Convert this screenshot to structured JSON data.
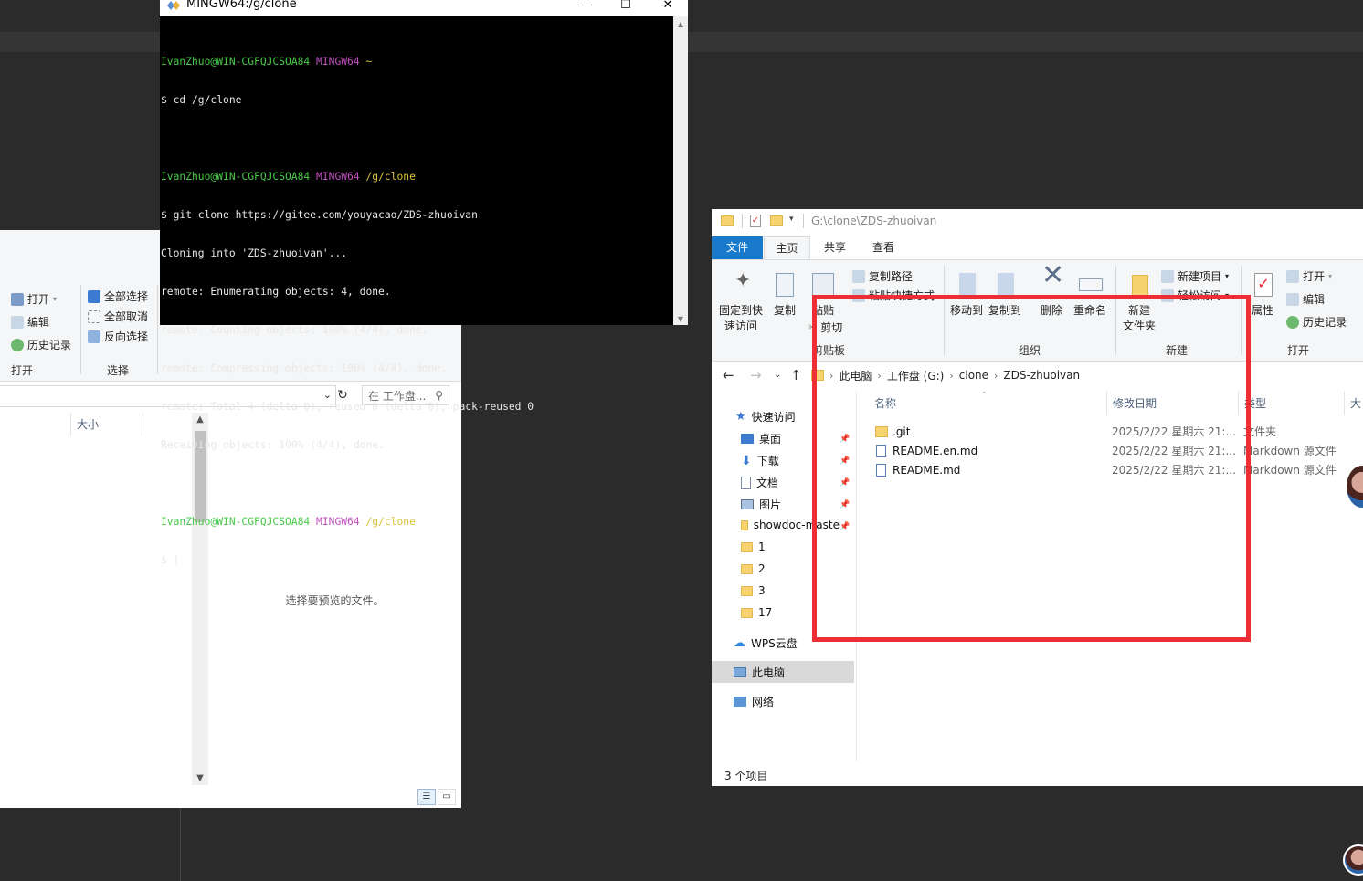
{
  "terminal": {
    "title": "MINGW64:/g/clone",
    "controls": {
      "minimize": "—",
      "maximize": "☐",
      "close": "✕"
    },
    "lines": [
      {
        "user_host": "IvanZhuo@WIN-CGFQJCSOA84",
        "shell": "MINGW64",
        "path": "~"
      },
      {
        "text": "$ cd /g/clone"
      },
      {
        "text": ""
      },
      {
        "user_host": "IvanZhuo@WIN-CGFQJCSOA84",
        "shell": "MINGW64",
        "path": "/g/clone"
      },
      {
        "text": "$ git clone https://gitee.com/youyacao/ZDS-zhuoivan"
      },
      {
        "text": "Cloning into 'ZDS-zhuoivan'..."
      },
      {
        "text": "remote: Enumerating objects: 4, done."
      },
      {
        "text": "remote: Counting objects: 100% (4/4), done."
      },
      {
        "text": "remote: Compressing objects: 100% (4/4), done."
      },
      {
        "text": "remote: Total 4 (delta 0), reused 0 (delta 0), pack-reused 0"
      },
      {
        "text": "Receiving objects: 100% (4/4), done."
      },
      {
        "text": ""
      },
      {
        "user_host": "IvanZhuo@WIN-CGFQJCSOA84",
        "shell": "MINGW64",
        "path": "/g/clone"
      },
      {
        "text": "$ |"
      }
    ]
  },
  "left_explorer": {
    "ribbon": {
      "open": "打开",
      "edit": "编辑",
      "history": "历史记录",
      "select_all": "全部选择",
      "select_none": "全部取消",
      "invert_select": "反向选择",
      "group_open": "打开",
      "group_select": "选择"
    },
    "search_placeholder": "在 工作盘...",
    "column_size": "大小",
    "preview_text": "选择要预览的文件。"
  },
  "right_explorer": {
    "qat_path": "G:\\clone\\ZDS-zhuoivan",
    "tabs": {
      "file": "文件",
      "home": "主页",
      "share": "共享",
      "view": "查看"
    },
    "ribbon": {
      "pin_quick_access": [
        "固定到快",
        "速访问"
      ],
      "copy": "复制",
      "paste": "粘贴",
      "copy_path": "复制路径",
      "paste_shortcut": "粘贴快捷方式",
      "cut": "剪切",
      "clipboard_group": "剪贴板",
      "move_to": "移动到",
      "copy_to": "复制到",
      "delete": "删除",
      "rename": "重命名",
      "organize_group": "组织",
      "new_folder": [
        "新建",
        "文件夹"
      ],
      "new_item": "新建项目",
      "easy_access": "轻松访问",
      "new_group": "新建",
      "properties": "属性",
      "open": "打开",
      "edit": "编辑",
      "history": "历史记录",
      "open_group": "打开"
    },
    "breadcrumbs": [
      "此电脑",
      "工作盘 (G:)",
      "clone",
      "ZDS-zhuoivan"
    ],
    "nav": {
      "quick_access": "快速访问",
      "items": [
        "桌面",
        "下载",
        "文档",
        "图片",
        "showdoc-maste",
        "1",
        "2",
        "3",
        "17"
      ],
      "wps": "WPS云盘",
      "this_pc": "此电脑",
      "network": "网络"
    },
    "columns": {
      "name": "名称",
      "modified": "修改日期",
      "type": "类型",
      "size": "大"
    },
    "files": [
      {
        "name": ".git",
        "modified": "2025/2/22 星期六 21:...",
        "type": "文件夹",
        "kind": "folder"
      },
      {
        "name": "README.en.md",
        "modified": "2025/2/22 星期六 21:...",
        "type": "Markdown 源文件",
        "kind": "doc"
      },
      {
        "name": "README.md",
        "modified": "2025/2/22 星期六 21:...",
        "type": "Markdown 源文件",
        "kind": "doc"
      }
    ],
    "status": "3 个项目"
  },
  "colors": {
    "highlight_box": "#ee2e35",
    "file_tab": "#1979ca",
    "term_green": "#49c949",
    "term_purple": "#c052c0",
    "term_yellow": "#d9c03a"
  }
}
